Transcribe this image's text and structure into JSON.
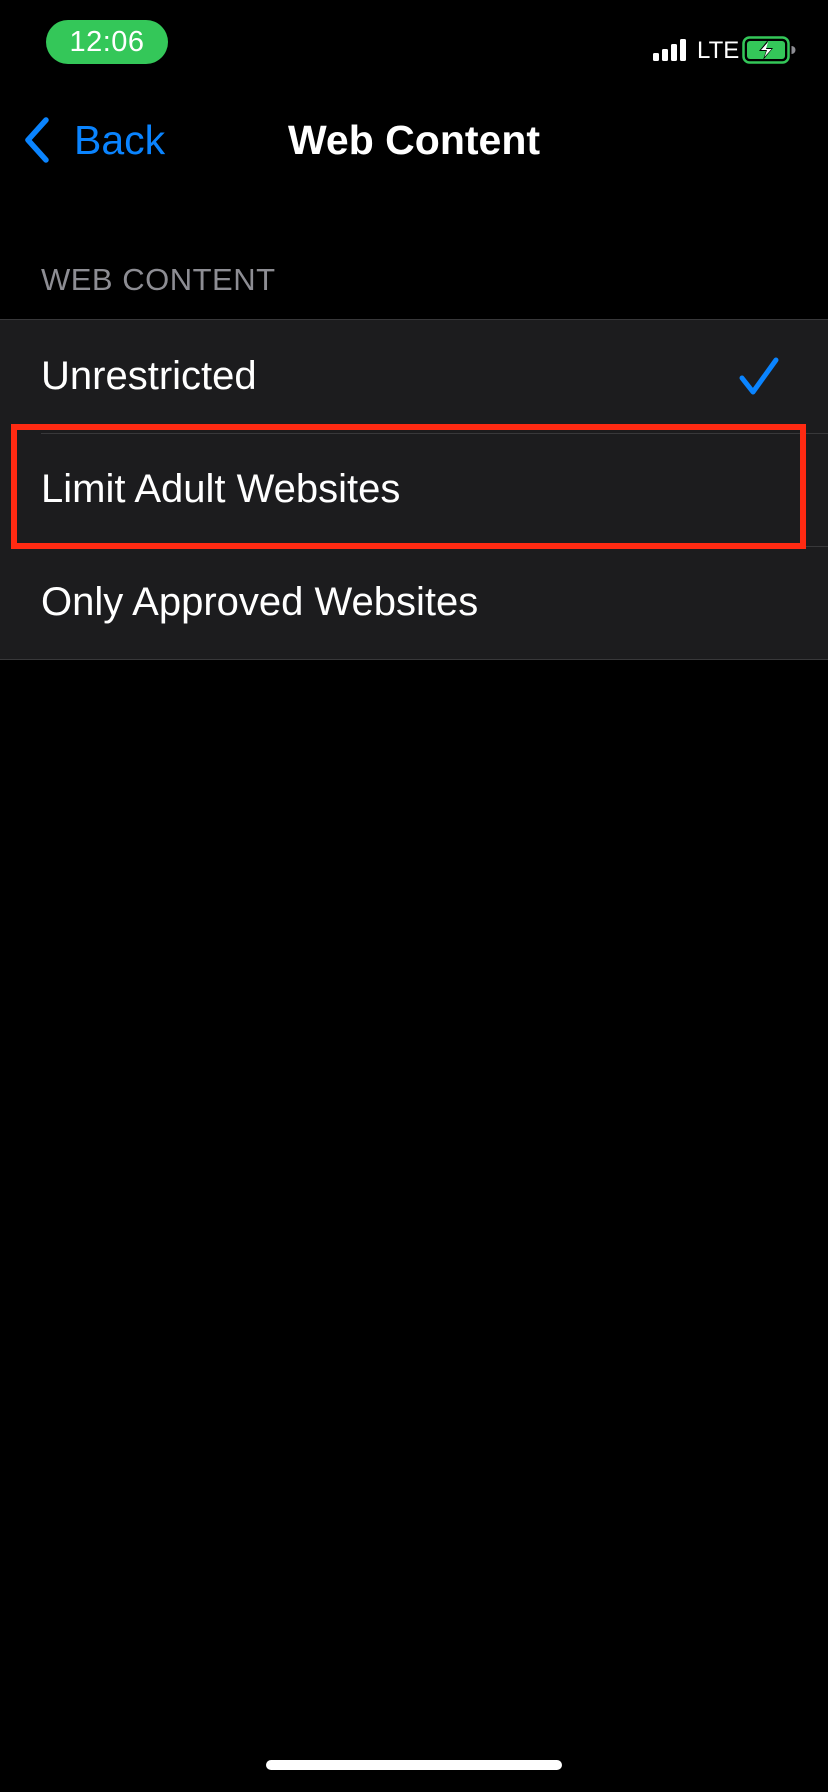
{
  "status_bar": {
    "time": "12:06",
    "network": "LTE",
    "icons": [
      "signal-icon",
      "battery-charging-icon"
    ],
    "time_pill_color": "#34c759",
    "battery_color": "#34c759"
  },
  "nav": {
    "back_label": "Back",
    "title": "Web Content",
    "accent_color": "#0a84ff",
    "back_icon": "chevron-left-icon"
  },
  "section": {
    "header": "WEB CONTENT",
    "options": [
      {
        "label": "Unrestricted",
        "selected": true
      },
      {
        "label": "Limit Adult Websites",
        "selected": false,
        "highlighted": true
      },
      {
        "label": "Only Approved Websites",
        "selected": false
      }
    ],
    "check_icon": "checkmark-icon"
  },
  "annotation": {
    "highlight_color": "#ff2a12"
  }
}
